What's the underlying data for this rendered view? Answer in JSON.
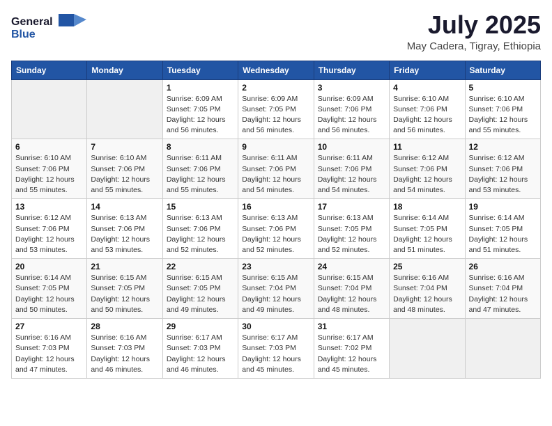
{
  "logo": {
    "general": "General",
    "blue": "Blue"
  },
  "header": {
    "month": "July 2025",
    "location": "May Cadera, Tigray, Ethiopia"
  },
  "weekdays": [
    "Sunday",
    "Monday",
    "Tuesday",
    "Wednesday",
    "Thursday",
    "Friday",
    "Saturday"
  ],
  "weeks": [
    [
      {
        "day": "",
        "sunrise": "",
        "sunset": "",
        "daylight": ""
      },
      {
        "day": "",
        "sunrise": "",
        "sunset": "",
        "daylight": ""
      },
      {
        "day": "1",
        "sunrise": "Sunrise: 6:09 AM",
        "sunset": "Sunset: 7:05 PM",
        "daylight": "Daylight: 12 hours and 56 minutes."
      },
      {
        "day": "2",
        "sunrise": "Sunrise: 6:09 AM",
        "sunset": "Sunset: 7:05 PM",
        "daylight": "Daylight: 12 hours and 56 minutes."
      },
      {
        "day": "3",
        "sunrise": "Sunrise: 6:09 AM",
        "sunset": "Sunset: 7:06 PM",
        "daylight": "Daylight: 12 hours and 56 minutes."
      },
      {
        "day": "4",
        "sunrise": "Sunrise: 6:10 AM",
        "sunset": "Sunset: 7:06 PM",
        "daylight": "Daylight: 12 hours and 56 minutes."
      },
      {
        "day": "5",
        "sunrise": "Sunrise: 6:10 AM",
        "sunset": "Sunset: 7:06 PM",
        "daylight": "Daylight: 12 hours and 55 minutes."
      }
    ],
    [
      {
        "day": "6",
        "sunrise": "Sunrise: 6:10 AM",
        "sunset": "Sunset: 7:06 PM",
        "daylight": "Daylight: 12 hours and 55 minutes."
      },
      {
        "day": "7",
        "sunrise": "Sunrise: 6:10 AM",
        "sunset": "Sunset: 7:06 PM",
        "daylight": "Daylight: 12 hours and 55 minutes."
      },
      {
        "day": "8",
        "sunrise": "Sunrise: 6:11 AM",
        "sunset": "Sunset: 7:06 PM",
        "daylight": "Daylight: 12 hours and 55 minutes."
      },
      {
        "day": "9",
        "sunrise": "Sunrise: 6:11 AM",
        "sunset": "Sunset: 7:06 PM",
        "daylight": "Daylight: 12 hours and 54 minutes."
      },
      {
        "day": "10",
        "sunrise": "Sunrise: 6:11 AM",
        "sunset": "Sunset: 7:06 PM",
        "daylight": "Daylight: 12 hours and 54 minutes."
      },
      {
        "day": "11",
        "sunrise": "Sunrise: 6:12 AM",
        "sunset": "Sunset: 7:06 PM",
        "daylight": "Daylight: 12 hours and 54 minutes."
      },
      {
        "day": "12",
        "sunrise": "Sunrise: 6:12 AM",
        "sunset": "Sunset: 7:06 PM",
        "daylight": "Daylight: 12 hours and 53 minutes."
      }
    ],
    [
      {
        "day": "13",
        "sunrise": "Sunrise: 6:12 AM",
        "sunset": "Sunset: 7:06 PM",
        "daylight": "Daylight: 12 hours and 53 minutes."
      },
      {
        "day": "14",
        "sunrise": "Sunrise: 6:13 AM",
        "sunset": "Sunset: 7:06 PM",
        "daylight": "Daylight: 12 hours and 53 minutes."
      },
      {
        "day": "15",
        "sunrise": "Sunrise: 6:13 AM",
        "sunset": "Sunset: 7:06 PM",
        "daylight": "Daylight: 12 hours and 52 minutes."
      },
      {
        "day": "16",
        "sunrise": "Sunrise: 6:13 AM",
        "sunset": "Sunset: 7:06 PM",
        "daylight": "Daylight: 12 hours and 52 minutes."
      },
      {
        "day": "17",
        "sunrise": "Sunrise: 6:13 AM",
        "sunset": "Sunset: 7:05 PM",
        "daylight": "Daylight: 12 hours and 52 minutes."
      },
      {
        "day": "18",
        "sunrise": "Sunrise: 6:14 AM",
        "sunset": "Sunset: 7:05 PM",
        "daylight": "Daylight: 12 hours and 51 minutes."
      },
      {
        "day": "19",
        "sunrise": "Sunrise: 6:14 AM",
        "sunset": "Sunset: 7:05 PM",
        "daylight": "Daylight: 12 hours and 51 minutes."
      }
    ],
    [
      {
        "day": "20",
        "sunrise": "Sunrise: 6:14 AM",
        "sunset": "Sunset: 7:05 PM",
        "daylight": "Daylight: 12 hours and 50 minutes."
      },
      {
        "day": "21",
        "sunrise": "Sunrise: 6:15 AM",
        "sunset": "Sunset: 7:05 PM",
        "daylight": "Daylight: 12 hours and 50 minutes."
      },
      {
        "day": "22",
        "sunrise": "Sunrise: 6:15 AM",
        "sunset": "Sunset: 7:05 PM",
        "daylight": "Daylight: 12 hours and 49 minutes."
      },
      {
        "day": "23",
        "sunrise": "Sunrise: 6:15 AM",
        "sunset": "Sunset: 7:04 PM",
        "daylight": "Daylight: 12 hours and 49 minutes."
      },
      {
        "day": "24",
        "sunrise": "Sunrise: 6:15 AM",
        "sunset": "Sunset: 7:04 PM",
        "daylight": "Daylight: 12 hours and 48 minutes."
      },
      {
        "day": "25",
        "sunrise": "Sunrise: 6:16 AM",
        "sunset": "Sunset: 7:04 PM",
        "daylight": "Daylight: 12 hours and 48 minutes."
      },
      {
        "day": "26",
        "sunrise": "Sunrise: 6:16 AM",
        "sunset": "Sunset: 7:04 PM",
        "daylight": "Daylight: 12 hours and 47 minutes."
      }
    ],
    [
      {
        "day": "27",
        "sunrise": "Sunrise: 6:16 AM",
        "sunset": "Sunset: 7:03 PM",
        "daylight": "Daylight: 12 hours and 47 minutes."
      },
      {
        "day": "28",
        "sunrise": "Sunrise: 6:16 AM",
        "sunset": "Sunset: 7:03 PM",
        "daylight": "Daylight: 12 hours and 46 minutes."
      },
      {
        "day": "29",
        "sunrise": "Sunrise: 6:17 AM",
        "sunset": "Sunset: 7:03 PM",
        "daylight": "Daylight: 12 hours and 46 minutes."
      },
      {
        "day": "30",
        "sunrise": "Sunrise: 6:17 AM",
        "sunset": "Sunset: 7:03 PM",
        "daylight": "Daylight: 12 hours and 45 minutes."
      },
      {
        "day": "31",
        "sunrise": "Sunrise: 6:17 AM",
        "sunset": "Sunset: 7:02 PM",
        "daylight": "Daylight: 12 hours and 45 minutes."
      },
      {
        "day": "",
        "sunrise": "",
        "sunset": "",
        "daylight": ""
      },
      {
        "day": "",
        "sunrise": "",
        "sunset": "",
        "daylight": ""
      }
    ]
  ]
}
